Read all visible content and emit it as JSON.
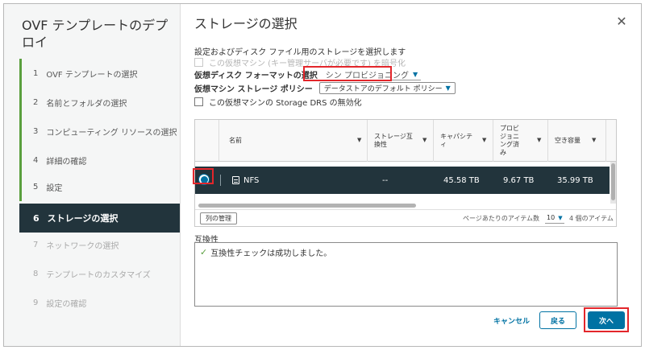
{
  "wizard": {
    "title": "OVF テンプレートのデプロイ",
    "steps": [
      {
        "num": "1",
        "label": "OVF テンプレートの選択"
      },
      {
        "num": "2",
        "label": "名前とフォルダの選択"
      },
      {
        "num": "3",
        "label": "コンピューティング リソースの選択"
      },
      {
        "num": "4",
        "label": "詳細の確認"
      },
      {
        "num": "5",
        "label": "設定"
      },
      {
        "num": "6",
        "label": "ストレージの選択"
      },
      {
        "num": "7",
        "label": "ネットワークの選択"
      },
      {
        "num": "8",
        "label": "テンプレートのカスタマイズ"
      },
      {
        "num": "9",
        "label": "設定の確認"
      }
    ],
    "active_step": 6
  },
  "page": {
    "title": "ストレージの選択",
    "description": "設定およびディスク ファイル用のストレージを選択します",
    "encrypt_label": "この仮想マシン (キー管理サーバが必要です) を暗号化",
    "disk_format_label": "仮想ディスク フォーマットの選択",
    "disk_format_value": "シン プロビジョニング",
    "policy_label": "仮想マシン ストレージ ポリシー",
    "policy_value": "データストアのデフォルト ポリシー",
    "drs_label": "この仮想マシンの Storage DRS の無効化"
  },
  "table": {
    "columns": [
      "名前",
      "ストレージ互換性",
      "キャパシティ",
      "プロビジョニング済み",
      "空き容量"
    ],
    "rows": [
      {
        "name": "NFS",
        "compat": "--",
        "capacity": "45.58 TB",
        "provisioned": "9.67 TB",
        "free": "35.99 TB"
      }
    ],
    "columns_button": "列の管理",
    "per_page_label": "ページあたりのアイテム数",
    "per_page_value": "10",
    "items_count": "4 個のアイテム"
  },
  "compatibility": {
    "label": "互換性",
    "message": "互換性チェックは成功しました。"
  },
  "buttons": {
    "cancel": "キャンセル",
    "back": "戻る",
    "next": "次へ"
  },
  "colors": {
    "accent": "#0072a3",
    "active_step_bg": "#22343c",
    "completed_marker": "#5a9f3e",
    "highlight_box": "#e3262b"
  }
}
